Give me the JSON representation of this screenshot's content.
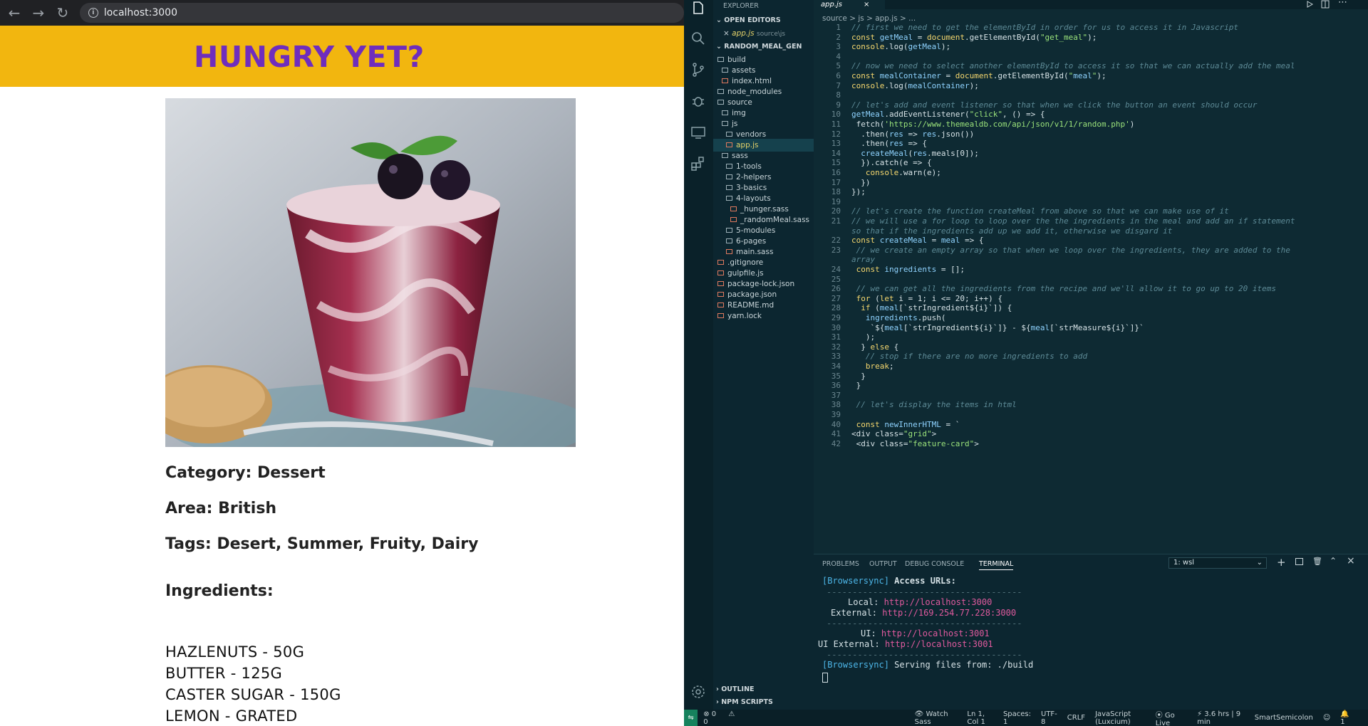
{
  "browser": {
    "url": "localhost:3000",
    "header_title": "HUNGRY YET?",
    "category": "Category: Dessert",
    "area": "Area: British",
    "tags": "Tags: Desert, Summer, Fruity, Dairy",
    "ingredients_heading": "Ingredients:",
    "ingredients": [
      "HAZLENUTS - 50G",
      "BUTTER - 125G",
      "CASTER SUGAR - 150G",
      "LEMON - GRATED"
    ]
  },
  "vscode": {
    "sidebar": {
      "explorer_title": "EXPLORER",
      "open_editors": "OPEN EDITORS",
      "open_file": "app.js",
      "open_file_path": "source\\js",
      "project": "RANDOM_MEAL_GEN",
      "tree": [
        "build",
        "assets",
        "index.html",
        "node_modules",
        "source",
        "img",
        "js",
        "vendors",
        "app.js",
        "sass",
        "1-tools",
        "2-helpers",
        "3-basics",
        "4-layouts",
        "_hunger.sass",
        "_randomMeal.sass",
        "5-modules",
        "6-pages",
        "main.sass",
        ".gitignore",
        "gulpfile.js",
        "package-lock.json",
        "package.json",
        "README.md",
        "yarn.lock"
      ],
      "outline": "OUTLINE",
      "npm_scripts": "NPM SCRIPTS"
    },
    "tab": "app.js",
    "breadcrumb": "source > js > app.js > ...",
    "code_lines": [
      "// first we need to get the elementById in order for us to access it in Javascript",
      "const getMeal = document.getElementById(\"get_meal\");",
      "console.log(getMeal);",
      "",
      "// now we need to select another elementById to access it so that we can actually add the meal",
      "const mealContainer = document.getElementById(\"meal\");",
      "console.log(mealContainer);",
      "",
      "// let's add and event listener so that when we click the button an event should occur",
      "getMeal.addEventListener(\"click\", () => {",
      " fetch('https://www.themealdb.com/api/json/v1/1/random.php')",
      "  .then(res => res.json())",
      "  .then(res => {",
      "  createMeal(res.meals[0]);",
      "  }).catch(e => {",
      "   console.warn(e);",
      "  })",
      "});",
      "",
      "// let's create the function createMeal from above so that we can make use of it",
      "// we will use a for loop to loop over the the ingredients in the meal and add an if statement",
      "const createMeal = meal => {",
      " // we create an empty array so that when we loop over the ingredients, they are added to the",
      " const ingredients = [];",
      "",
      " // we can get all the ingredients from the recipe and we'll allow it to go up to 20 items",
      " for (let i = 1; i <= 20; i++) {",
      "  if (meal[`strIngredient${i}`]) {",
      "   ingredients.push(",
      "    `${meal[`strIngredient${i}`]} - ${meal[`strMeasure${i}`]}`",
      "   );",
      "  } else {",
      "   // stop if there are no more ingredients to add",
      "   break;",
      "  }",
      " }",
      "",
      " // let's display the items in html",
      "",
      " const newInnerHTML = `",
      "<div class=\"grid\">",
      " <div class=\"feature-card\">"
    ],
    "code_wrap_21": "so that if the ingredients add up we add it, otherwise we disgard it",
    "code_wrap_23": "array",
    "panel_tabs": [
      "PROBLEMS",
      "OUTPUT",
      "DEBUG CONSOLE",
      "TERMINAL"
    ],
    "terminal_select": "1: wsl",
    "terminal": {
      "tag": "[Browsersync]",
      "access": "Access URLs:",
      "divider": "--------------------------------------",
      "local_label": "Local:",
      "local_url": "http://localhost:3000",
      "external_label": "External:",
      "external_url": "http://169.254.77.228:3000",
      "ui_label": "UI:",
      "ui_url": "http://localhost:3001",
      "ui_external_label": "UI External:",
      "ui_external_url": "http://localhost:3001",
      "serving": "Serving files from: ./build"
    },
    "status": {
      "errors": "0",
      "warnings": "0",
      "watch_sass": "Watch Sass",
      "position": "Ln 1, Col 1",
      "spaces": "Spaces: 1",
      "encoding": "UTF-8",
      "eol": "CRLF",
      "language": "JavaScript (Luxcium)",
      "go_live": "Go Live",
      "time": "3.6 hrs | 9 min",
      "smart": "SmartSemicolon",
      "bell": "1"
    }
  }
}
